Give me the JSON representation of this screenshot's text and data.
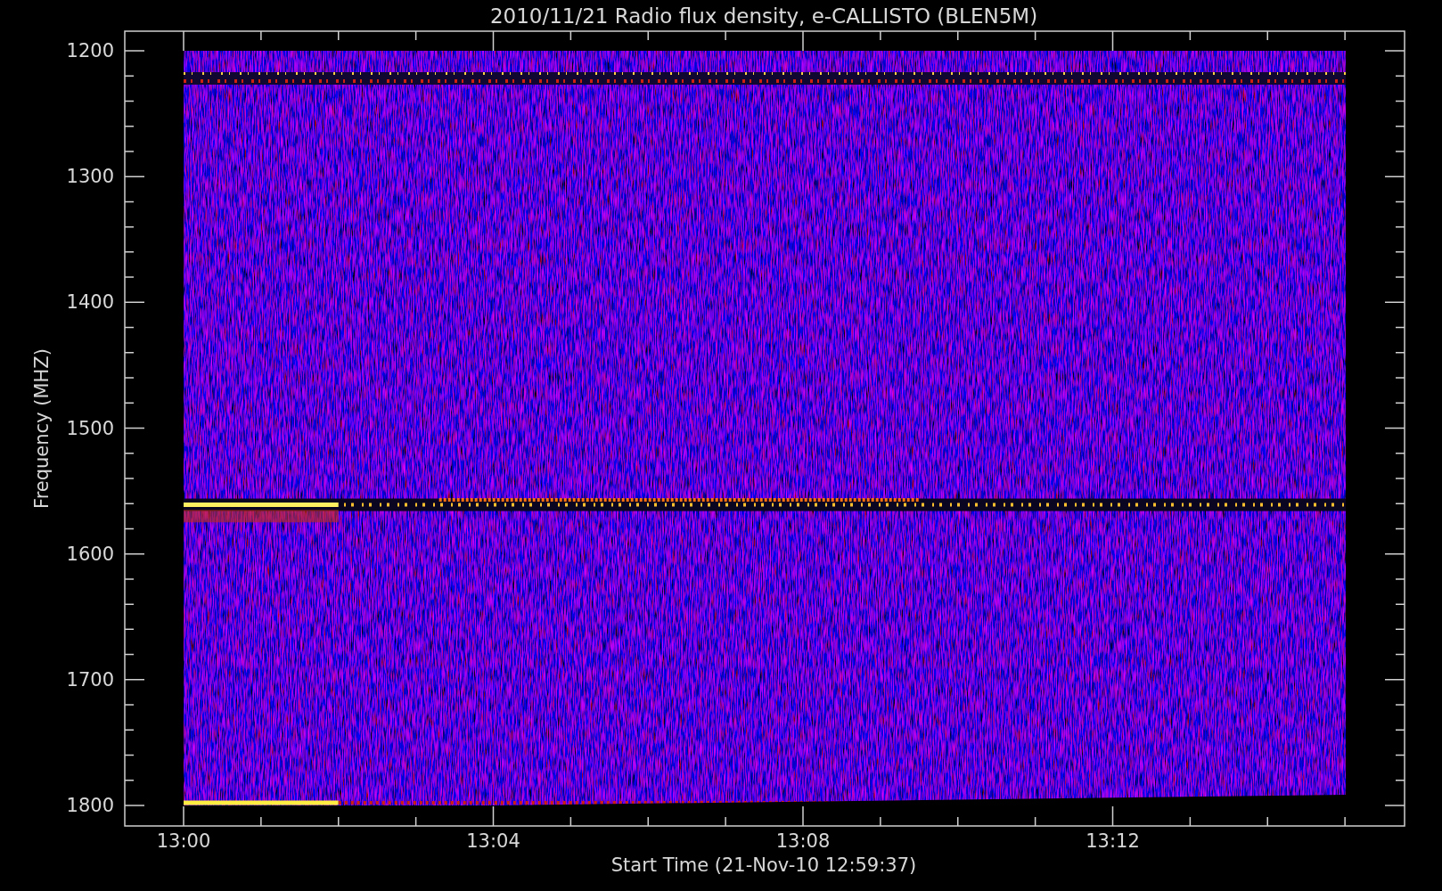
{
  "plot": {
    "title": "2010/11/21  Radio flux density, e-CALLISTO (BLEN5M)",
    "ylabel": "Frequency (MHZ)",
    "xlabel": "Start Time (21-Nov-10 12:59:37)",
    "yticks": [
      "1200",
      "1300",
      "1400",
      "1500",
      "1600",
      "1700",
      "1800"
    ],
    "xticks": [
      "13:00",
      "13:04",
      "13:08",
      "13:12"
    ]
  }
}
